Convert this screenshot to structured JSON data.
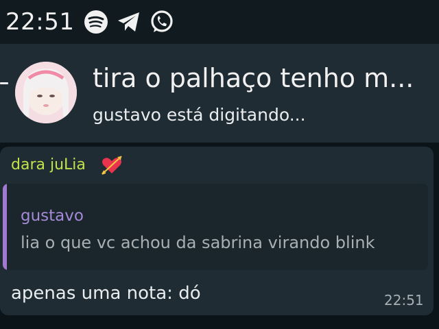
{
  "status_bar": {
    "time": "22:51",
    "icons": [
      "spotify-icon",
      "telegram-icon",
      "whatsapp-icon"
    ]
  },
  "header": {
    "title": "tira o palhaço tenho m...",
    "subtitle": "gustavo está digitando..."
  },
  "message": {
    "sender": "dara juLia",
    "reaction_icon": "heart-arrow-icon",
    "quote": {
      "author": "gustavo",
      "text": "lia o que vc achou da sabrina virando blink"
    },
    "text": "apenas uma nota: dó",
    "time": "22:51"
  },
  "colors": {
    "header_bg": "#202c33",
    "bubble_bg": "#1f2c34",
    "sender_color": "#c2e24b",
    "quote_accent": "#a07ad0"
  }
}
